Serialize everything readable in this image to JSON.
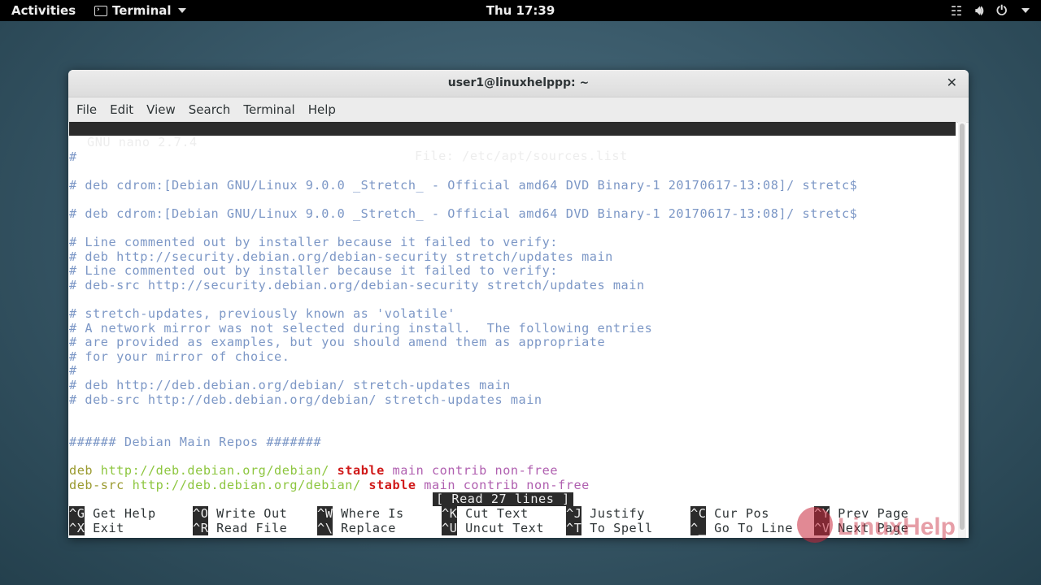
{
  "topbar": {
    "activities": "Activities",
    "app": "Terminal",
    "clock": "Thu 17:39"
  },
  "window": {
    "title": "user1@linuxhelppp: ~",
    "menu": [
      "File",
      "Edit",
      "View",
      "Search",
      "Terminal",
      "Help"
    ]
  },
  "nano": {
    "version": "GNU nano 2.7.4",
    "file": "File: /etc/apt/sources.list",
    "status": "[ Read 27 lines ]",
    "lines": {
      "l1": "#",
      "l2": "# deb cdrom:[Debian GNU/Linux 9.0.0 _Stretch_ - Official amd64 DVD Binary-1 20170617-13:08]/ stretc$",
      "l3": "# deb cdrom:[Debian GNU/Linux 9.0.0 _Stretch_ - Official amd64 DVD Binary-1 20170617-13:08]/ stretc$",
      "l4": "# Line commented out by installer because it failed to verify:",
      "l5": "# deb http://security.debian.org/debian-security stretch/updates main",
      "l6": "# Line commented out by installer because it failed to verify:",
      "l7": "# deb-src http://security.debian.org/debian-security stretch/updates main",
      "l8": "# stretch-updates, previously known as 'volatile'",
      "l9": "# A network mirror was not selected during install.  The following entries",
      "l10": "# are provided as examples, but you should amend them as appropriate",
      "l11": "# for your mirror of choice.",
      "l12": "#",
      "l13": "# deb http://deb.debian.org/debian/ stretch-updates main",
      "l14": "# deb-src http://deb.debian.org/debian/ stretch-updates main",
      "l15": "###### Debian Main Repos #######"
    },
    "repo1": {
      "type": "deb",
      "url": "http://deb.debian.org/debian/",
      "suite": "stable",
      "components": "main contrib non-free"
    },
    "repo2": {
      "type": "deb-src",
      "url": "http://deb.debian.org/debian/",
      "suite": "stable",
      "components": "main contrib non-free"
    },
    "shortcuts": [
      {
        "key": "^G",
        "label": "Get Help"
      },
      {
        "key": "^O",
        "label": "Write Out"
      },
      {
        "key": "^W",
        "label": "Where Is"
      },
      {
        "key": "^K",
        "label": "Cut Text"
      },
      {
        "key": "^J",
        "label": "Justify"
      },
      {
        "key": "^C",
        "label": "Cur Pos"
      },
      {
        "key": "^Y",
        "label": "Prev Page"
      },
      {
        "key": "^X",
        "label": "Exit"
      },
      {
        "key": "^R",
        "label": "Read File"
      },
      {
        "key": "^\\",
        "label": "Replace"
      },
      {
        "key": "^U",
        "label": "Uncut Text"
      },
      {
        "key": "^T",
        "label": "To Spell"
      },
      {
        "key": "^_",
        "label": "Go To Line"
      },
      {
        "key": "^V",
        "label": "Next Page"
      }
    ]
  },
  "watermark": "LinuxHelp",
  "colors": {
    "comment": "#7c97c6",
    "url": "#8dc63f",
    "stable": "#d01a1a",
    "components": "#b060b0"
  }
}
